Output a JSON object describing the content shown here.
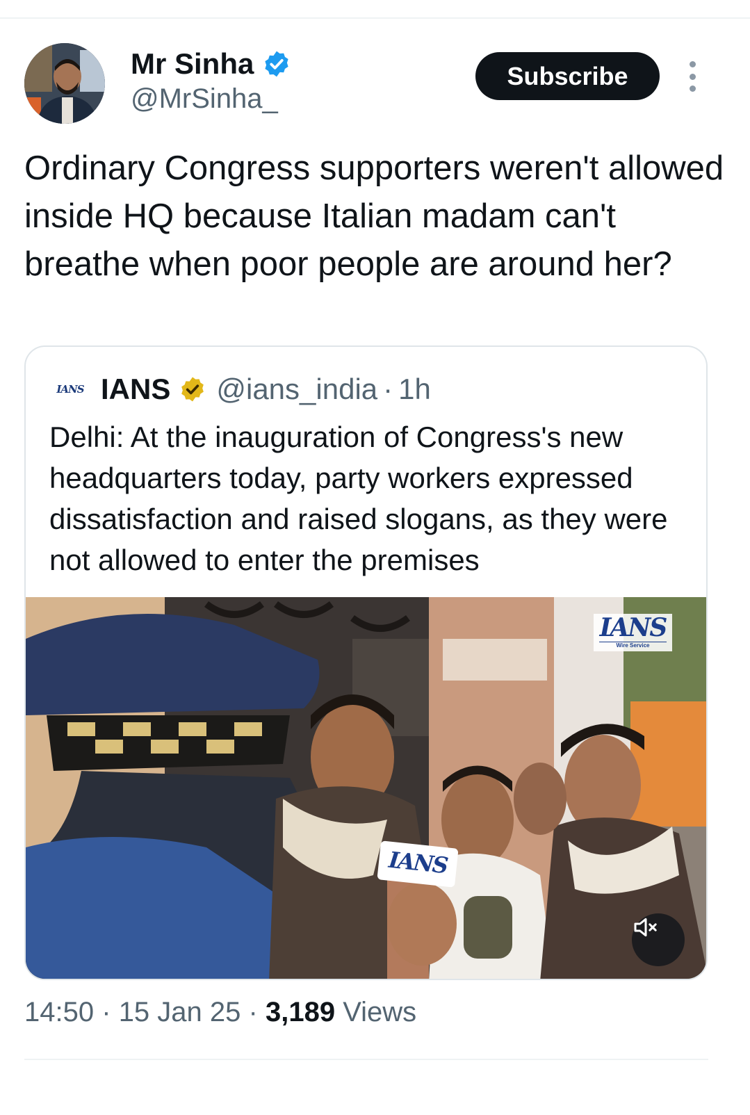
{
  "author": {
    "name": "Mr Sinha",
    "handle": "@MrSinha_",
    "verified_color": "#1d9bf0"
  },
  "actions": {
    "subscribe_label": "Subscribe",
    "more_icon": "more-vertical-icon"
  },
  "tweet": {
    "text": "Ordinary Congress supporters weren't allowed inside HQ because Italian madam can't breathe when poor people are around her?"
  },
  "quoted": {
    "avatar_text": "IANS",
    "name": "IANS",
    "badge_color": "#e2b719",
    "handle": "@ians_india",
    "separator": "·",
    "time": "1h",
    "text": "Delhi: At the inauguration of Congress's new headquarters today, party workers expressed dissatisfaction and raised slogans, as they were not allowed to enter the premises",
    "media": {
      "watermark": "IANS",
      "watermark_sub": "Wire Service",
      "mic_label": "IANS",
      "mute_icon": "volume-muted-icon"
    }
  },
  "meta": {
    "time": "14:50",
    "sep1": "·",
    "date": "15 Jan 25",
    "sep2": "·",
    "views_count": "3,189",
    "views_label": "Views"
  }
}
